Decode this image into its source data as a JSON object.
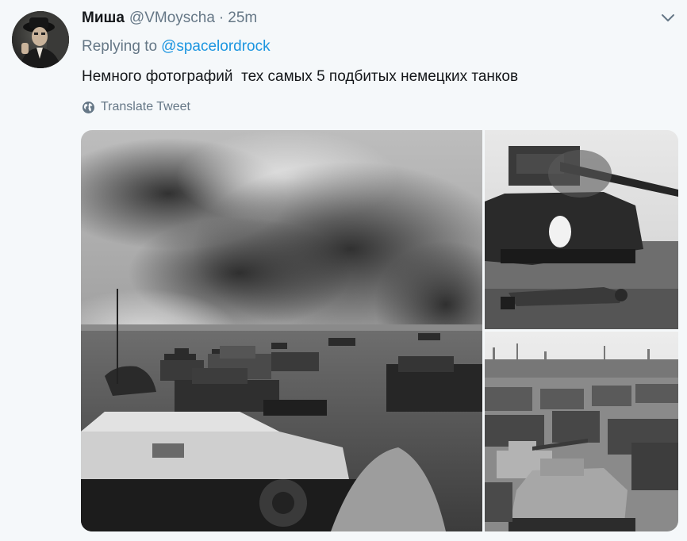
{
  "tweet": {
    "author_name": "Миша",
    "author_handle": "@VMoyscha",
    "separator": "·",
    "time": "25m",
    "replying_prefix": "Replying to",
    "replying_to": "@spacelordrock",
    "text": "Немного фотографий  тех самых 5 подбитых немецких танков",
    "translate_label": "Translate Tweet"
  },
  "icons": {
    "caret": "chevron-down-icon",
    "translate": "globe-icon"
  },
  "media": {
    "photo_count": 3,
    "style": "black-and-white"
  },
  "colors": {
    "background": "#f5f8fa",
    "text": "#14171a",
    "secondary_text": "#657786",
    "link": "#1b95e0"
  }
}
